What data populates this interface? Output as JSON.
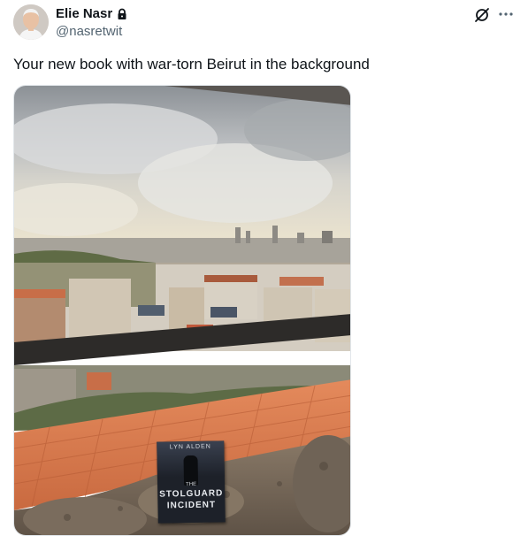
{
  "author": {
    "display_name": "Elie Nasr",
    "handle": "@nasretwit",
    "protected_icon": "lock-icon"
  },
  "actions": {
    "grok_icon": "grok-icon",
    "more_icon": "more-icon"
  },
  "tweet": {
    "text": "Your new book with war-torn Beirut in the background"
  },
  "book": {
    "author": "LYN ALDEN",
    "title_line_1": "THE",
    "title_line_2": "STOLGUARD",
    "title_line_3": "INCIDENT"
  },
  "colors": {
    "text_primary": "#0f1419",
    "text_secondary": "#536471",
    "roof_tiles": "#d9744a"
  }
}
